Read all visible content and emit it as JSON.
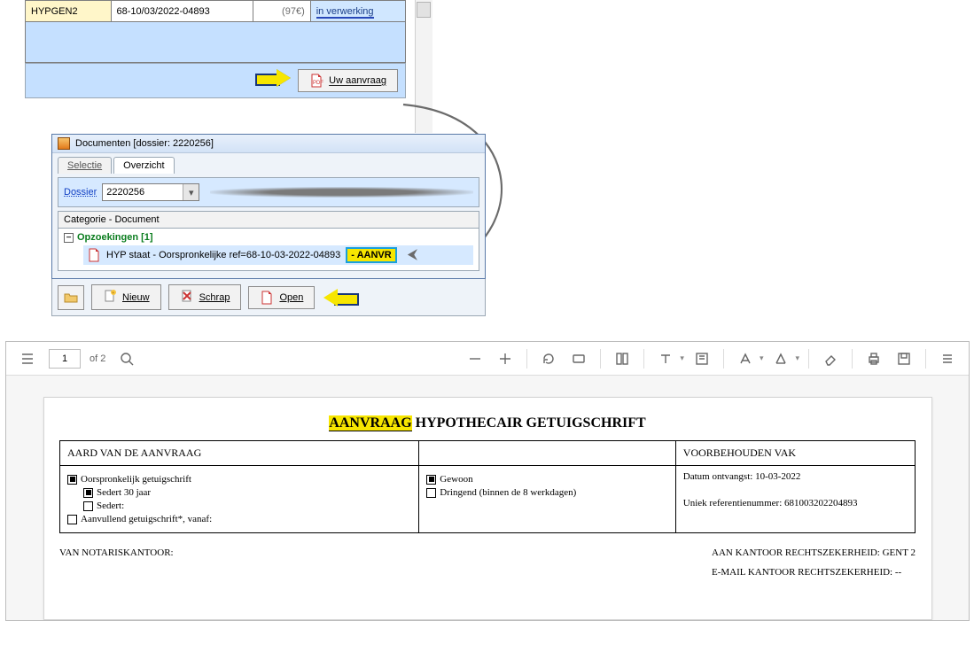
{
  "top_grid": {
    "row": {
      "col1": "HYPGEN2",
      "col2": "68-10/03/2022-04893",
      "col3": "(97€)",
      "col4": "in verwerking"
    }
  },
  "aanvraag_button": "Uw aanvraag",
  "doc_window": {
    "title": "Documenten  [dossier: 2220256]",
    "tabs": {
      "selectie": "Selectie",
      "overzicht": "Overzicht"
    },
    "dossier_label": "Dossier",
    "dossier_value": "2220256",
    "cat_header": "Categorie - Document",
    "tree": {
      "group": "Opzoekingen [1]",
      "leaf_text": "HYP staat - Oorspronkelijke  ref=68-10-03-2022-04893 ",
      "leaf_tag": "- AANVR"
    }
  },
  "doc_toolbar": {
    "nieuw": "Nieuw",
    "schrap": "Schrap",
    "open": "Open"
  },
  "pdf_toolbar": {
    "page_current": "1",
    "page_total": "of 2"
  },
  "pdf_document": {
    "title_hl": "AANVRAAG",
    "title_rest": " HYPOTHECAIR GETUIGSCHRIFT",
    "col1_header": "AARD VAN DE AANVRAAG",
    "col1": {
      "l1": "Oorspronkelijk getuigschrift",
      "l2": "Sedert 30 jaar",
      "l3": "Sedert:",
      "l4": "Aanvullend getuigschrift*, vanaf:"
    },
    "col2": {
      "l1": "Gewoon",
      "l2": "Dringend (binnen de 8 werkdagen)"
    },
    "col3_header": "VOORBEHOUDEN VAK",
    "col3": {
      "l1": "Datum ontvangst: 10-03-2022",
      "l2": "Uniek referentienummer: 681003202204893"
    },
    "footer_left": "VAN NOTARISKANTOOR:",
    "footer_r1": "AAN KANTOOR RECHTSZEKERHEID: GENT 2",
    "footer_r2": "E-MAIL KANTOOR RECHTSZEKERHEID: --"
  }
}
